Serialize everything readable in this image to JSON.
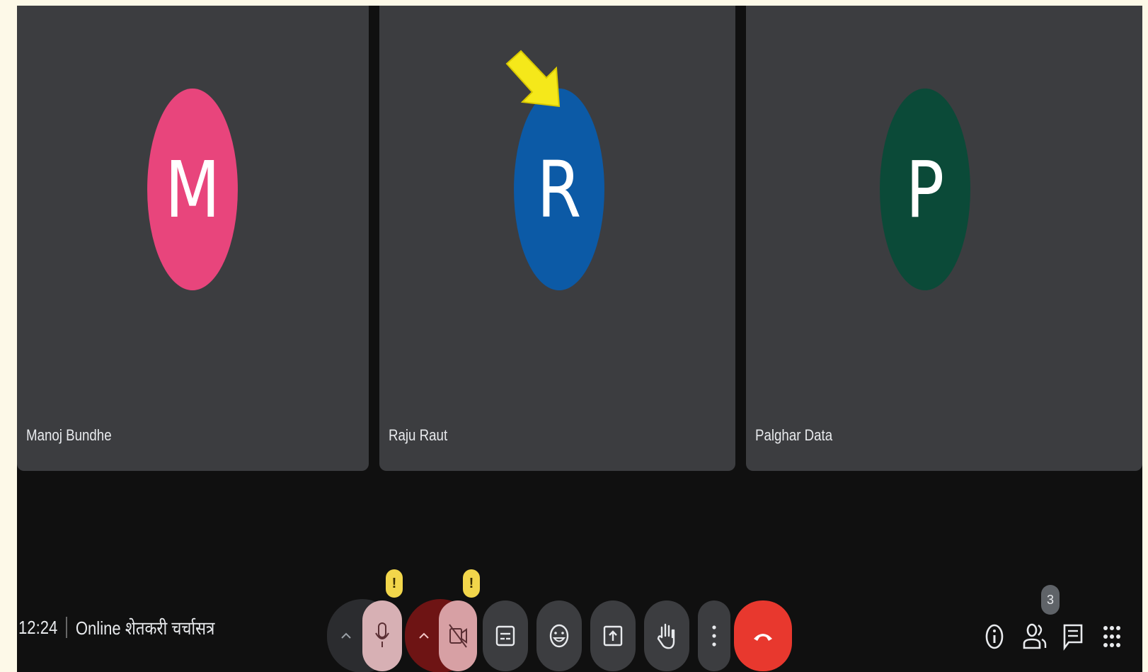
{
  "participants": [
    {
      "initial": "M",
      "name": "Manoj Bundhe",
      "color": "#e8457c"
    },
    {
      "initial": "R",
      "name": "Raju Raut",
      "color": "#0c5aa6"
    },
    {
      "initial": "P",
      "name": "Palghar Data",
      "color": "#0b4a38"
    }
  ],
  "meeting": {
    "time": "12:24",
    "title": "Online शेतकरी चर्चासत्र"
  },
  "controls": {
    "mic_warning": "!",
    "camera_warning": "!",
    "people_count": "3",
    "hangup_color": "#e8382e"
  },
  "colors": {
    "tile_bg": "#3c3d40",
    "bar_bg": "#101010",
    "highlight_arrow": "#f5e81a"
  }
}
